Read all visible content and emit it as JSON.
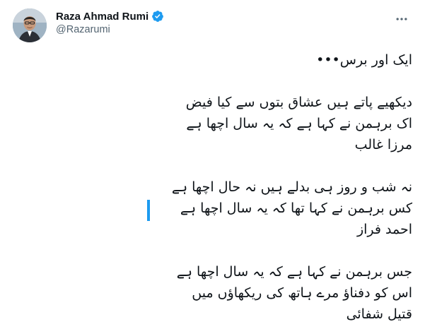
{
  "tweet": {
    "author": {
      "display_name": "Raza Ahmad Rumi",
      "handle": "@Razarumi",
      "verified": true
    },
    "icons": {
      "more": "more-horizontal-icon",
      "verified": "verified-badge-icon"
    },
    "colors": {
      "verified": "#1d9bf0",
      "text": "#0f1419",
      "secondary": "#536471"
    },
    "body": {
      "title": "ایک اور برس•••",
      "stanza_1": {
        "line_1": "دیکھیے پاتے ہیں عشاق بتوں سے کیا فیض",
        "line_2": "اک برہمن نے کہا ہے کہ یہ سال اچھا ہے",
        "poet": "مرزا غالب"
      },
      "stanza_2": {
        "line_1": "نہ شب و روز ہی بدلے ہیں نہ حال اچھا ہے",
        "line_2": "کس برہمن نے کہا تھا کہ یہ سال اچھا ہے",
        "poet": "احمد فراز"
      },
      "stanza_3": {
        "line_1": "جس برہمن نے کہا ہے کہ یہ سال اچھا ہے",
        "line_2": "اس کو دفناؤ مرے ہاتھ کی ریکھاؤں میں",
        "poet": "قتیل شفائی"
      }
    }
  }
}
